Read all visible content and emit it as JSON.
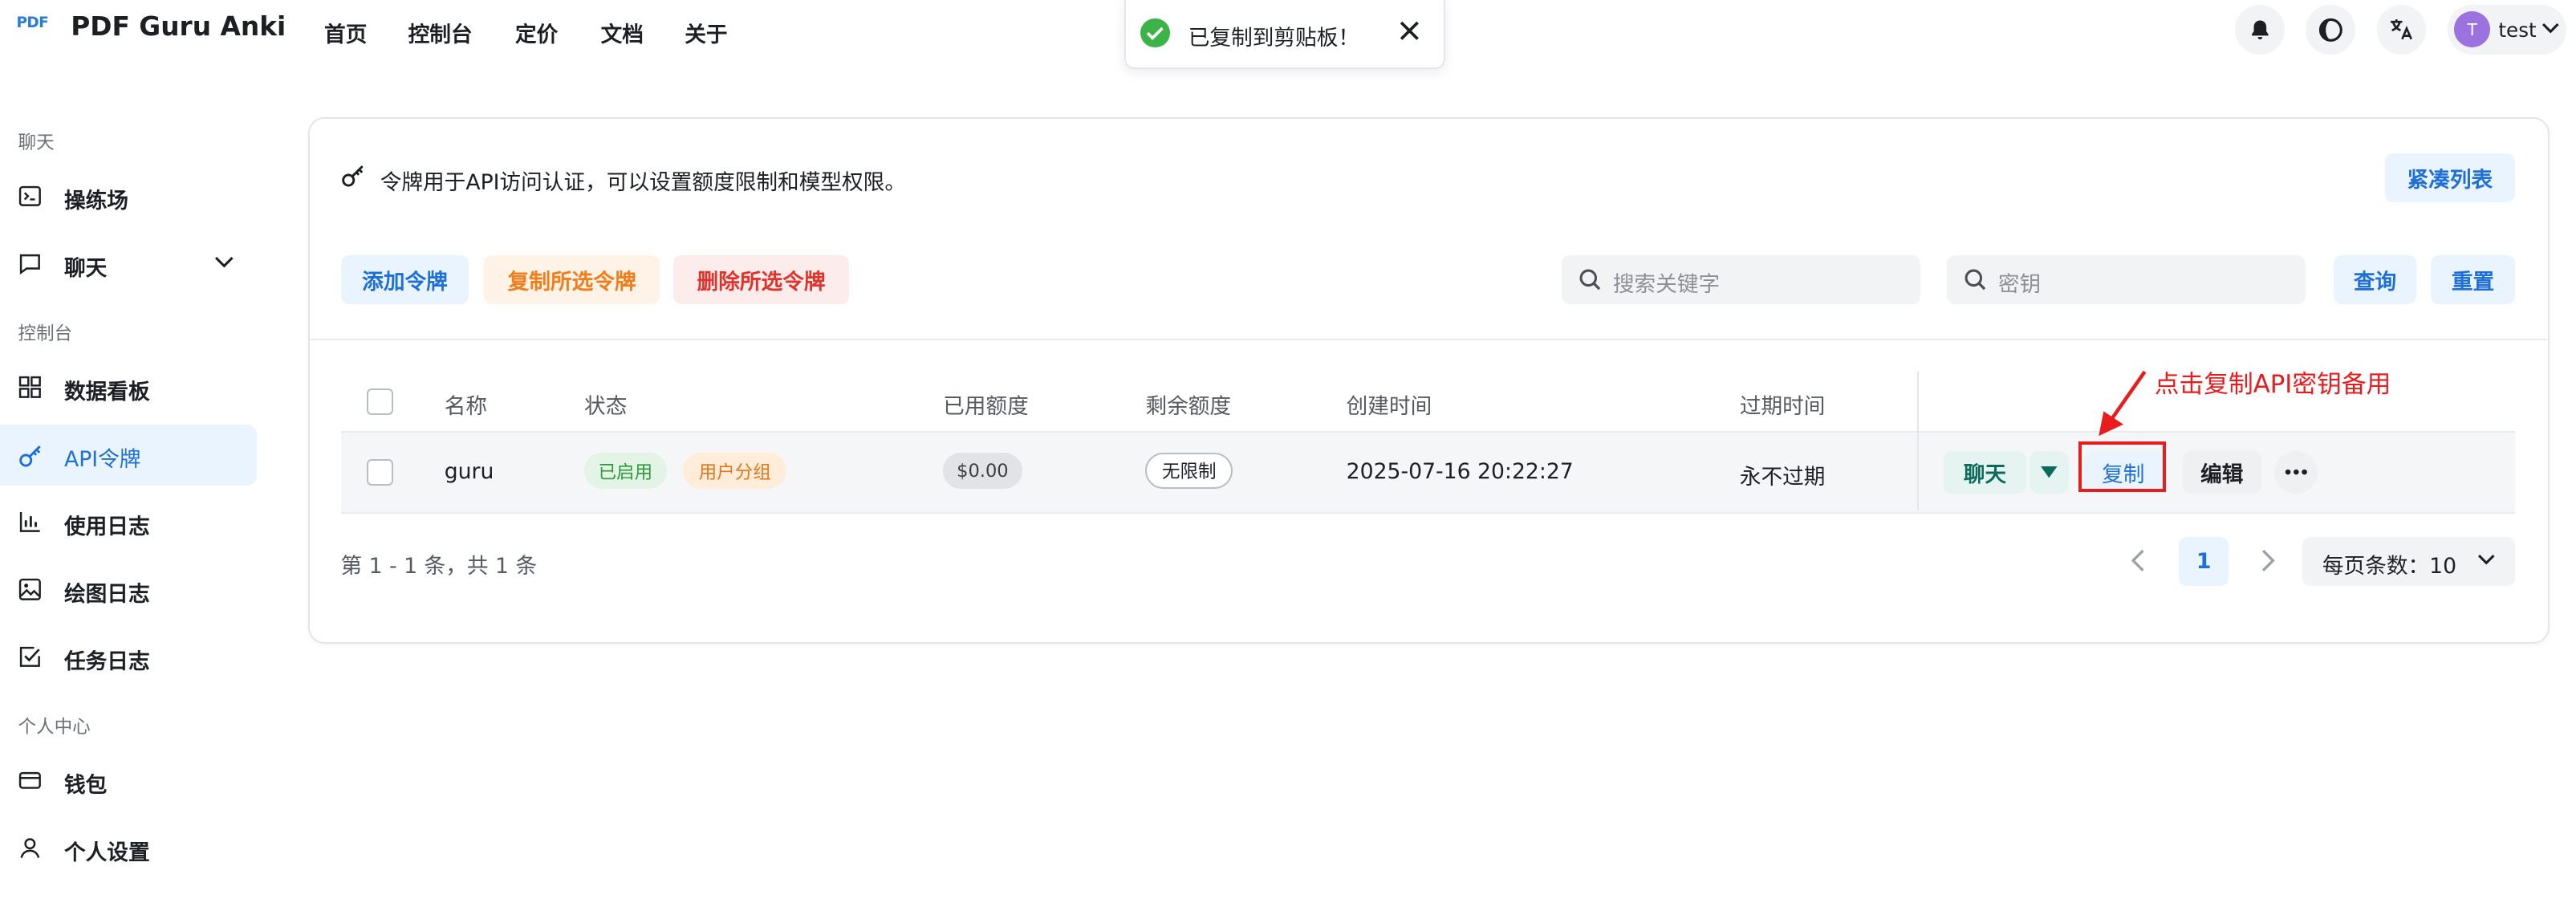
{
  "header": {
    "logo_text": "PDF",
    "app_name": "PDF Guru Anki",
    "nav": [
      "首页",
      "控制台",
      "定价",
      "文档",
      "关于"
    ],
    "user": {
      "avatar_letter": "T",
      "name": "test"
    }
  },
  "toast": {
    "message": "已复制到剪贴板！"
  },
  "sidebar": {
    "groups": [
      {
        "title": "聊天",
        "items": [
          {
            "label": "操练场",
            "icon": "terminal-icon"
          },
          {
            "label": "聊天",
            "icon": "chat-icon"
          }
        ]
      },
      {
        "title": "控制台",
        "items": [
          {
            "label": "数据看板",
            "icon": "dashboard-icon"
          },
          {
            "label": "API令牌",
            "icon": "key-icon",
            "active": true
          },
          {
            "label": "使用日志",
            "icon": "bar-chart-icon"
          },
          {
            "label": "绘图日志",
            "icon": "image-icon"
          },
          {
            "label": "任务日志",
            "icon": "task-check-icon"
          }
        ]
      },
      {
        "title": "个人中心",
        "items": [
          {
            "label": "钱包",
            "icon": "wallet-icon"
          },
          {
            "label": "个人设置",
            "icon": "user-icon"
          }
        ]
      }
    ]
  },
  "card": {
    "description": "令牌用于API访问认证，可以设置额度限制和模型权限。",
    "compact_button": "紧凑列表",
    "toolbar": {
      "add": "添加令牌",
      "copy_selected": "复制所选令牌",
      "delete_selected": "删除所选令牌",
      "keyword_placeholder": "搜索关键字",
      "key_placeholder": "密钥",
      "query": "查询",
      "reset": "重置"
    },
    "table": {
      "columns": [
        "名称",
        "状态",
        "已用额度",
        "剩余额度",
        "创建时间",
        "过期时间"
      ],
      "rows": [
        {
          "name": "guru",
          "status": "已启用",
          "group": "用户分组",
          "used_quota": "$0.00",
          "remaining_quota": "无限制",
          "created_at": "2025-07-16 20:22:27",
          "expires": "永不过期",
          "actions": {
            "chat": "聊天",
            "copy": "复制",
            "edit": "编辑"
          }
        }
      ]
    },
    "annotation": "点击复制API密钥备用",
    "pagination": {
      "summary": "第 1 - 1 条，共 1 条",
      "current_page": "1",
      "page_size": "每页条数：10"
    }
  },
  "colors": {
    "accent": "#1f6fd8",
    "success": "#3bb346",
    "warning": "#f27d1b",
    "danger": "#e0332c",
    "annotation": "#e81c1c"
  }
}
